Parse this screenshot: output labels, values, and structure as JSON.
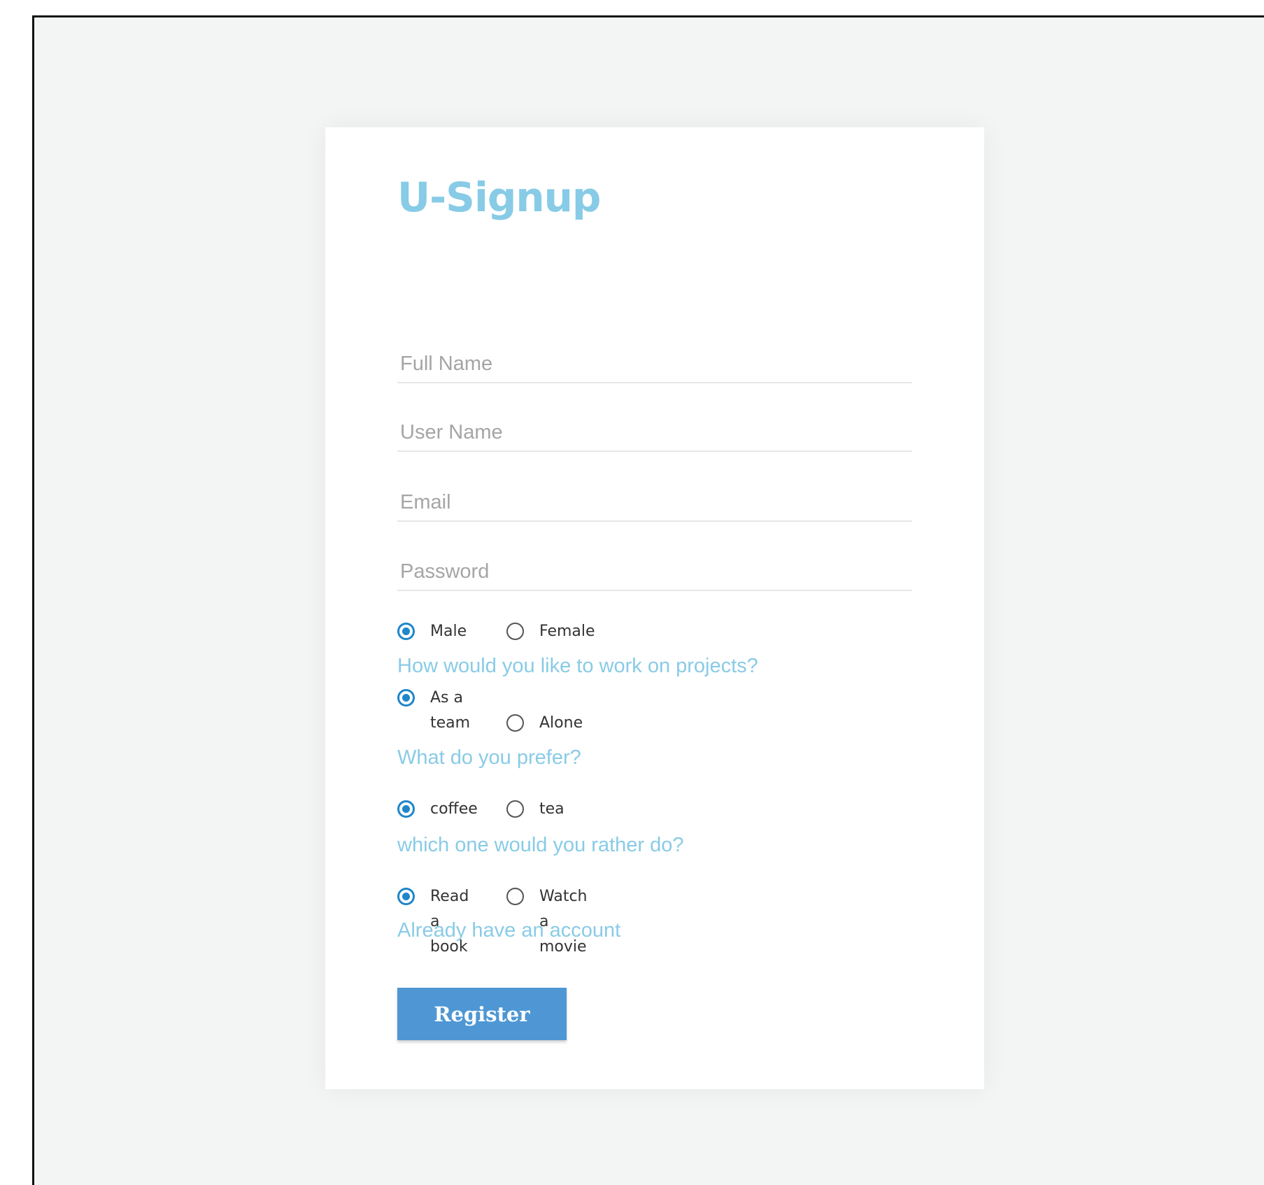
{
  "form": {
    "title": "U-Signup",
    "fields": {
      "full_name": "Full Name",
      "user_name": "User Name",
      "email": "Email",
      "password": "Password"
    },
    "gender": {
      "options": [
        "Male",
        "Female"
      ],
      "selected": "Male"
    },
    "projects": {
      "question": "How would you like to work on projects?",
      "options": [
        "As a team",
        "Alone"
      ],
      "selected": "As a team"
    },
    "prefer": {
      "question": "What do you prefer?",
      "options": [
        "coffee",
        "tea"
      ],
      "selected": "coffee"
    },
    "rather": {
      "question": "which one would you rather do?",
      "options": [
        "Read a book",
        "Watch a movie"
      ],
      "selected": "Read a book"
    },
    "account_link": "Already have an account",
    "register_label": "Register"
  },
  "colors": {
    "background": "#f3f5f4",
    "accent": "#87cbe6",
    "radio": "#1f86c9",
    "button": "#4e97d4"
  }
}
